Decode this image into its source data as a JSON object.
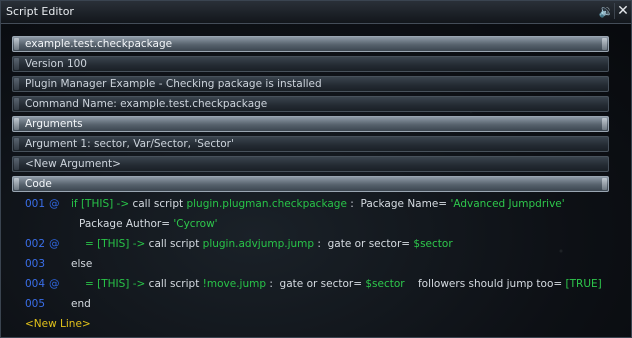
{
  "window": {
    "title": "Script Editor",
    "sound_icon": "sound-icon",
    "close_icon": "close-icon"
  },
  "rows": {
    "script_name": "example.test.checkpackage",
    "version": "Version 100",
    "description": "Plugin Manager Example - Checking package is installed",
    "command_name": "Command Name: example.test.checkpackage",
    "arguments_header": "Arguments",
    "argument_1": "Argument 1: sector, Var/Sector, 'Sector'",
    "new_argument": "<New Argument>",
    "code_header": "Code"
  },
  "code": {
    "l1": {
      "num": "001",
      "at": "@",
      "a": "if [THIS] ->",
      "b": " call script ",
      "c": "plugin.plugman.checkpackage",
      "d": " :  Package Name= ",
      "e": "'Advanced Jumpdrive'"
    },
    "l1b": {
      "a": "Package Author= ",
      "b": "'Cycrow'"
    },
    "l2": {
      "num": "002",
      "at": "@",
      "a": "= [THIS] ->",
      "b": " call script ",
      "c": "plugin.advjump.jump",
      "d": " :  gate or sector= ",
      "e": "$sector"
    },
    "l3": {
      "num": "003",
      "a": "else"
    },
    "l4": {
      "num": "004",
      "at": "@",
      "a": "= [THIS] ->",
      "b": " call script ",
      "c": "!move.jump",
      "d": " :  gate or sector= ",
      "e": "$sector",
      "f": "    followers should jump too= ",
      "g": "[TRUE]"
    },
    "l5": {
      "num": "005",
      "a": "end"
    },
    "new_line": "<New Line>"
  },
  "colors": {
    "line_number": "#3a6ee8",
    "keyword": "#28c448",
    "text": "#d6dce2",
    "new_line": "#e2c21a"
  }
}
